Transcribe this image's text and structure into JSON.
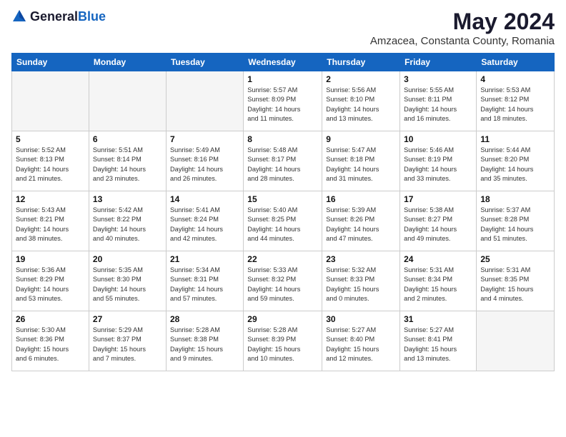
{
  "logo": {
    "general": "General",
    "blue": "Blue"
  },
  "header": {
    "month": "May 2024",
    "location": "Amzacea, Constanta County, Romania"
  },
  "weekdays": [
    "Sunday",
    "Monday",
    "Tuesday",
    "Wednesday",
    "Thursday",
    "Friday",
    "Saturday"
  ],
  "weeks": [
    [
      {
        "day": "",
        "info": ""
      },
      {
        "day": "",
        "info": ""
      },
      {
        "day": "",
        "info": ""
      },
      {
        "day": "1",
        "info": "Sunrise: 5:57 AM\nSunset: 8:09 PM\nDaylight: 14 hours\nand 11 minutes."
      },
      {
        "day": "2",
        "info": "Sunrise: 5:56 AM\nSunset: 8:10 PM\nDaylight: 14 hours\nand 13 minutes."
      },
      {
        "day": "3",
        "info": "Sunrise: 5:55 AM\nSunset: 8:11 PM\nDaylight: 14 hours\nand 16 minutes."
      },
      {
        "day": "4",
        "info": "Sunrise: 5:53 AM\nSunset: 8:12 PM\nDaylight: 14 hours\nand 18 minutes."
      }
    ],
    [
      {
        "day": "5",
        "info": "Sunrise: 5:52 AM\nSunset: 8:13 PM\nDaylight: 14 hours\nand 21 minutes."
      },
      {
        "day": "6",
        "info": "Sunrise: 5:51 AM\nSunset: 8:14 PM\nDaylight: 14 hours\nand 23 minutes."
      },
      {
        "day": "7",
        "info": "Sunrise: 5:49 AM\nSunset: 8:16 PM\nDaylight: 14 hours\nand 26 minutes."
      },
      {
        "day": "8",
        "info": "Sunrise: 5:48 AM\nSunset: 8:17 PM\nDaylight: 14 hours\nand 28 minutes."
      },
      {
        "day": "9",
        "info": "Sunrise: 5:47 AM\nSunset: 8:18 PM\nDaylight: 14 hours\nand 31 minutes."
      },
      {
        "day": "10",
        "info": "Sunrise: 5:46 AM\nSunset: 8:19 PM\nDaylight: 14 hours\nand 33 minutes."
      },
      {
        "day": "11",
        "info": "Sunrise: 5:44 AM\nSunset: 8:20 PM\nDaylight: 14 hours\nand 35 minutes."
      }
    ],
    [
      {
        "day": "12",
        "info": "Sunrise: 5:43 AM\nSunset: 8:21 PM\nDaylight: 14 hours\nand 38 minutes."
      },
      {
        "day": "13",
        "info": "Sunrise: 5:42 AM\nSunset: 8:22 PM\nDaylight: 14 hours\nand 40 minutes."
      },
      {
        "day": "14",
        "info": "Sunrise: 5:41 AM\nSunset: 8:24 PM\nDaylight: 14 hours\nand 42 minutes."
      },
      {
        "day": "15",
        "info": "Sunrise: 5:40 AM\nSunset: 8:25 PM\nDaylight: 14 hours\nand 44 minutes."
      },
      {
        "day": "16",
        "info": "Sunrise: 5:39 AM\nSunset: 8:26 PM\nDaylight: 14 hours\nand 47 minutes."
      },
      {
        "day": "17",
        "info": "Sunrise: 5:38 AM\nSunset: 8:27 PM\nDaylight: 14 hours\nand 49 minutes."
      },
      {
        "day": "18",
        "info": "Sunrise: 5:37 AM\nSunset: 8:28 PM\nDaylight: 14 hours\nand 51 minutes."
      }
    ],
    [
      {
        "day": "19",
        "info": "Sunrise: 5:36 AM\nSunset: 8:29 PM\nDaylight: 14 hours\nand 53 minutes."
      },
      {
        "day": "20",
        "info": "Sunrise: 5:35 AM\nSunset: 8:30 PM\nDaylight: 14 hours\nand 55 minutes."
      },
      {
        "day": "21",
        "info": "Sunrise: 5:34 AM\nSunset: 8:31 PM\nDaylight: 14 hours\nand 57 minutes."
      },
      {
        "day": "22",
        "info": "Sunrise: 5:33 AM\nSunset: 8:32 PM\nDaylight: 14 hours\nand 59 minutes."
      },
      {
        "day": "23",
        "info": "Sunrise: 5:32 AM\nSunset: 8:33 PM\nDaylight: 15 hours\nand 0 minutes."
      },
      {
        "day": "24",
        "info": "Sunrise: 5:31 AM\nSunset: 8:34 PM\nDaylight: 15 hours\nand 2 minutes."
      },
      {
        "day": "25",
        "info": "Sunrise: 5:31 AM\nSunset: 8:35 PM\nDaylight: 15 hours\nand 4 minutes."
      }
    ],
    [
      {
        "day": "26",
        "info": "Sunrise: 5:30 AM\nSunset: 8:36 PM\nDaylight: 15 hours\nand 6 minutes."
      },
      {
        "day": "27",
        "info": "Sunrise: 5:29 AM\nSunset: 8:37 PM\nDaylight: 15 hours\nand 7 minutes."
      },
      {
        "day": "28",
        "info": "Sunrise: 5:28 AM\nSunset: 8:38 PM\nDaylight: 15 hours\nand 9 minutes."
      },
      {
        "day": "29",
        "info": "Sunrise: 5:28 AM\nSunset: 8:39 PM\nDaylight: 15 hours\nand 10 minutes."
      },
      {
        "day": "30",
        "info": "Sunrise: 5:27 AM\nSunset: 8:40 PM\nDaylight: 15 hours\nand 12 minutes."
      },
      {
        "day": "31",
        "info": "Sunrise: 5:27 AM\nSunset: 8:41 PM\nDaylight: 15 hours\nand 13 minutes."
      },
      {
        "day": "",
        "info": ""
      }
    ]
  ]
}
